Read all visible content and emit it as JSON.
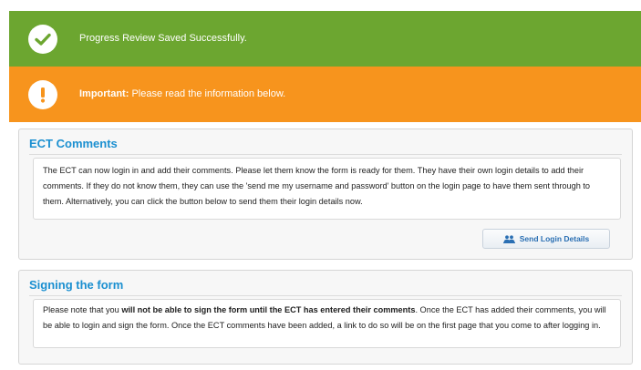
{
  "banners": {
    "success": {
      "icon": "check-icon",
      "message": "Progress Review Saved Successfully.",
      "color": "#6ca630"
    },
    "warning": {
      "icon": "exclamation-icon",
      "label": "Important:",
      "message": " Please read the information below.",
      "color": "#f7941d"
    }
  },
  "ect_comments": {
    "title": "ECT Comments",
    "body": "The ECT can now login in and add their comments. Please let them know the form is ready for them. They have their own login details to add their comments. If they do not know them, they can use the 'send me my username and password' button on the login page to have them sent through to them. Alternatively, you can click the button below to send them their login details now.",
    "button_label": "Send Login Details",
    "button_icon": "users-icon"
  },
  "signing": {
    "title": "Signing the form",
    "body_pre": "Please note that you ",
    "body_bold": "will not be able to sign the form until the ECT has entered their comments",
    "body_post": ". Once the ECT has added their comments, you will be able to login and sign the form. Once the ECT comments have been added, a link to do so will be on the first page that you come to after logging in."
  },
  "colors": {
    "heading": "#1a8fd0",
    "button_text": "#2a6fb3"
  }
}
